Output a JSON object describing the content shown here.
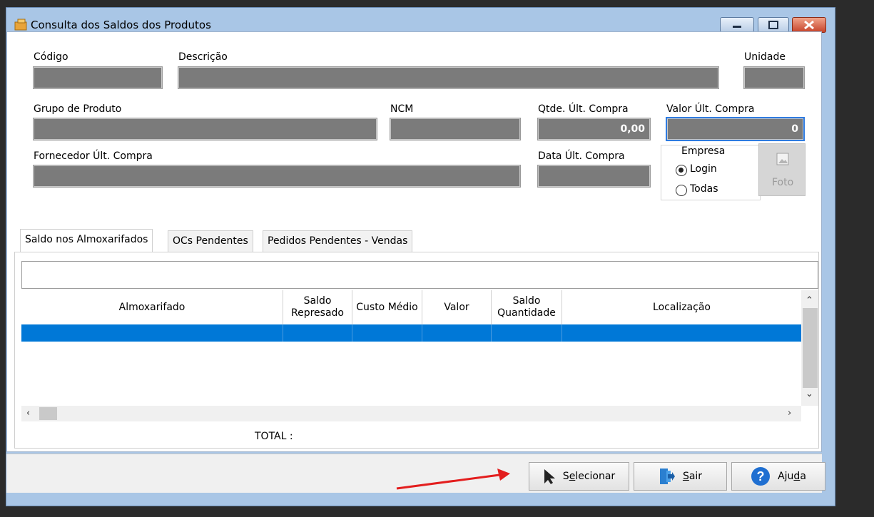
{
  "window": {
    "title": "Consulta dos Saldos dos Produtos"
  },
  "form": {
    "codigo_label": "Código",
    "descricao_label": "Descrição",
    "unidade_label": "Unidade",
    "grupo_label": "Grupo de Produto",
    "ncm_label": "NCM",
    "qtde_label": "Qtde. Últ. Compra",
    "qtde_value": "0,00",
    "valor_label": "Valor Últ. Compra",
    "valor_value": "0",
    "fornecedor_label": "Fornecedor Últ. Compra",
    "data_label": "Data Últ. Compra"
  },
  "empresa": {
    "label": "Empresa",
    "options": [
      "Login",
      "Todas"
    ],
    "selected": "Login"
  },
  "foto_button": {
    "label": "Foto"
  },
  "tabs": [
    "Saldo nos Almoxarifados",
    "OCs Pendentes",
    "Pedidos Pendentes - Vendas"
  ],
  "grid": {
    "columns": [
      "Almoxarifado",
      "Saldo Represado",
      "Custo Médio",
      "Valor",
      "Saldo Quantidade",
      "Localização"
    ],
    "total_label": "TOTAL :"
  },
  "buttons": {
    "selecionar": {
      "pre": "S",
      "key": "e",
      "post": "lecionar"
    },
    "sair": {
      "pre": "",
      "key": "S",
      "post": "air"
    },
    "ajuda": {
      "pre": "Aju",
      "key": "d",
      "post": "a"
    }
  },
  "colors": {
    "selected_row": "#0078d7",
    "annotation_arrow": "#e31e1e"
  }
}
